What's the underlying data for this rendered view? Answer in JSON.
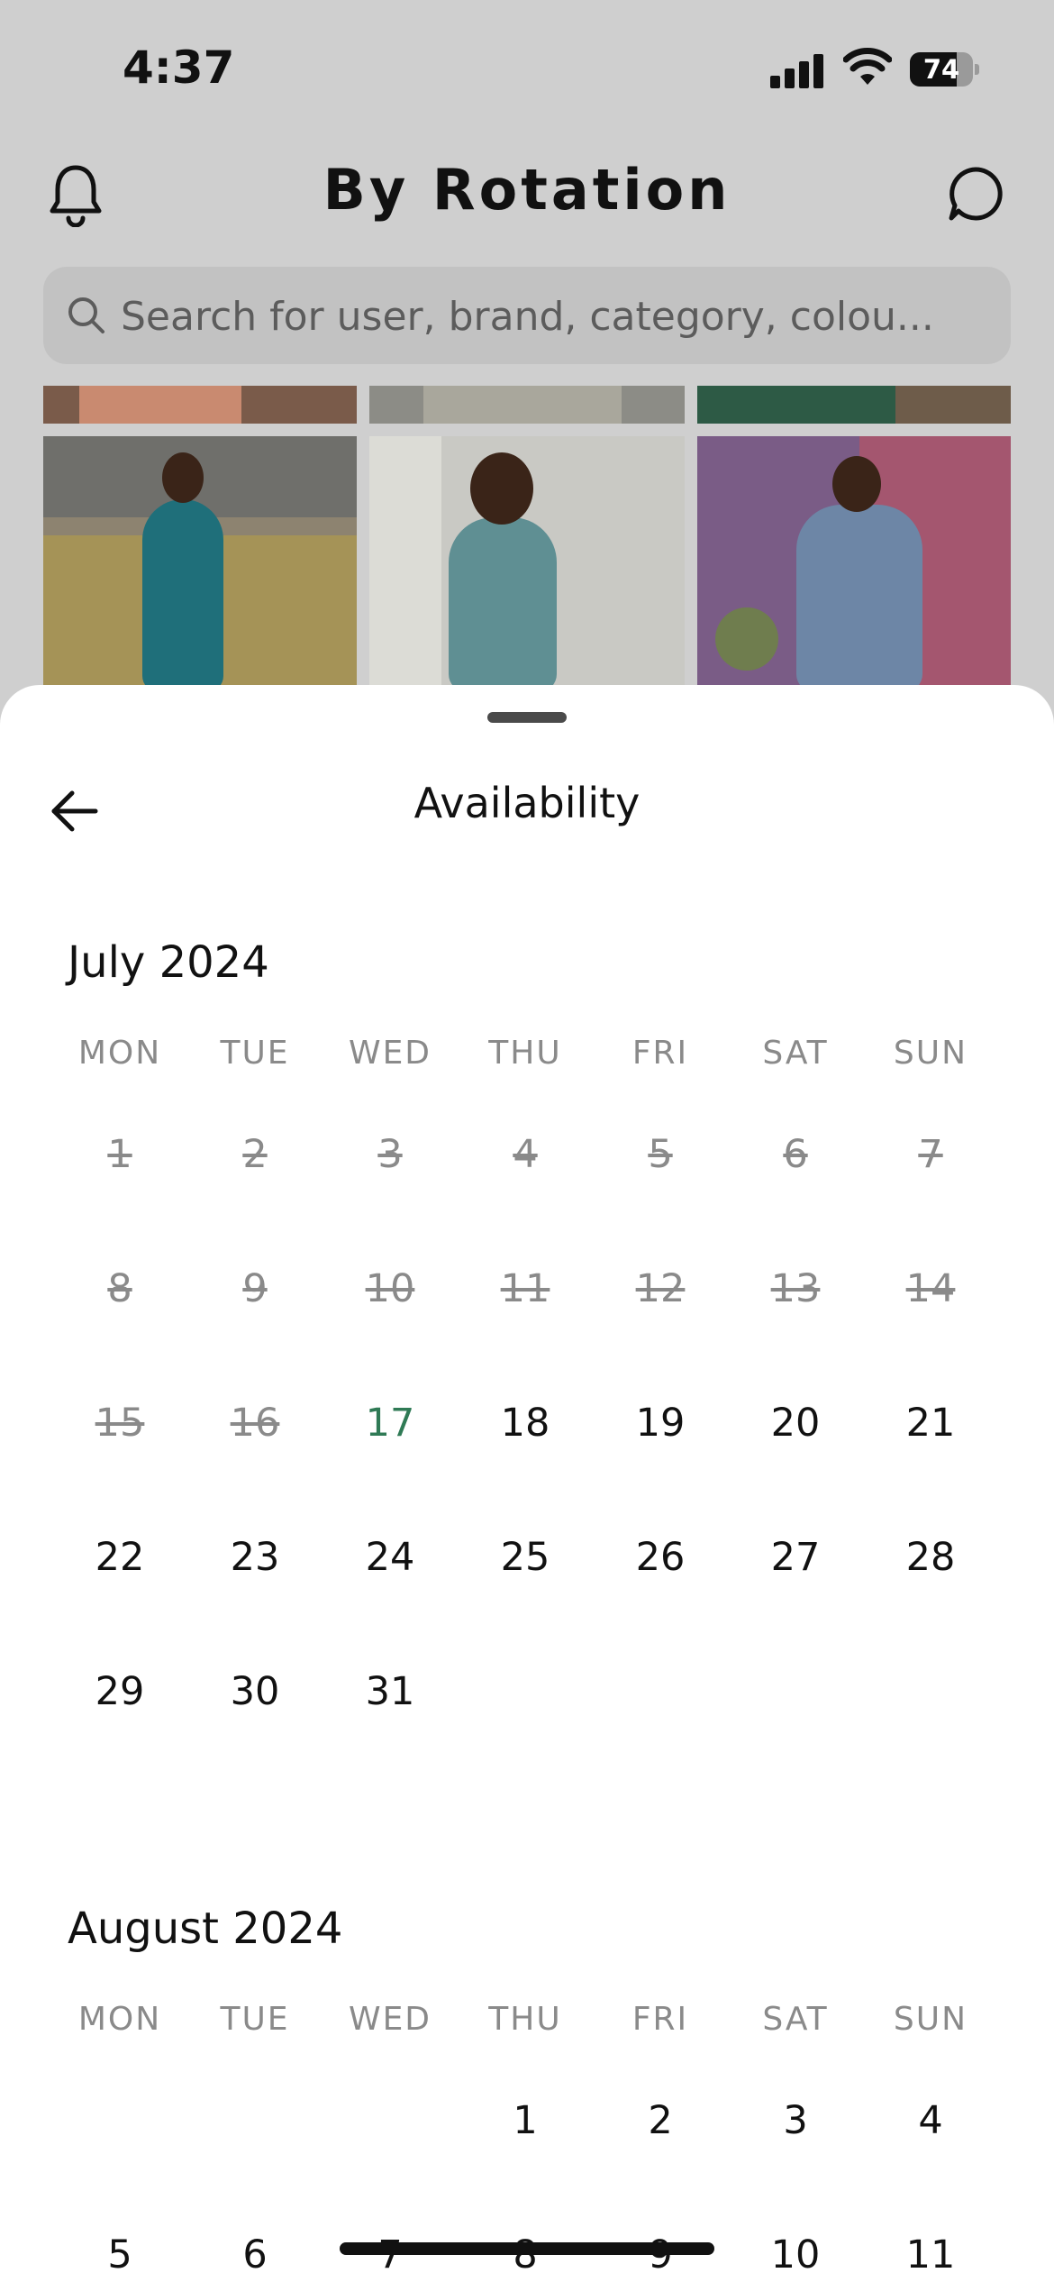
{
  "status_bar": {
    "time": "4:37",
    "battery_percent": "74",
    "battery_level": 0.74
  },
  "header": {
    "title": "By Rotation",
    "bell_icon": "bell-icon",
    "chat_icon": "chat-bubble-icon"
  },
  "search": {
    "placeholder": "Search for user, brand, category, colou..."
  },
  "sheet": {
    "title": "Availability",
    "back_icon": "arrow-left-icon",
    "colors": {
      "available": "#111111",
      "unavailable": "#8a8a8a",
      "today": "#2f7a55"
    },
    "months": [
      {
        "name": "July 2024",
        "weekdays": [
          "MON",
          "TUE",
          "WED",
          "THU",
          "FRI",
          "SAT",
          "SUN"
        ],
        "first_weekday_index": 0,
        "days": [
          {
            "n": "1",
            "state": "past"
          },
          {
            "n": "2",
            "state": "past"
          },
          {
            "n": "3",
            "state": "past"
          },
          {
            "n": "4",
            "state": "past"
          },
          {
            "n": "5",
            "state": "past"
          },
          {
            "n": "6",
            "state": "past"
          },
          {
            "n": "7",
            "state": "past"
          },
          {
            "n": "8",
            "state": "past"
          },
          {
            "n": "9",
            "state": "past"
          },
          {
            "n": "10",
            "state": "past"
          },
          {
            "n": "11",
            "state": "past"
          },
          {
            "n": "12",
            "state": "past"
          },
          {
            "n": "13",
            "state": "past"
          },
          {
            "n": "14",
            "state": "past"
          },
          {
            "n": "15",
            "state": "past"
          },
          {
            "n": "16",
            "state": "past"
          },
          {
            "n": "17",
            "state": "today"
          },
          {
            "n": "18",
            "state": "available"
          },
          {
            "n": "19",
            "state": "available"
          },
          {
            "n": "20",
            "state": "available"
          },
          {
            "n": "21",
            "state": "available"
          },
          {
            "n": "22",
            "state": "available"
          },
          {
            "n": "23",
            "state": "available"
          },
          {
            "n": "24",
            "state": "available"
          },
          {
            "n": "25",
            "state": "available"
          },
          {
            "n": "26",
            "state": "available"
          },
          {
            "n": "27",
            "state": "available"
          },
          {
            "n": "28",
            "state": "available"
          },
          {
            "n": "29",
            "state": "available"
          },
          {
            "n": "30",
            "state": "available"
          },
          {
            "n": "31",
            "state": "available"
          }
        ]
      },
      {
        "name": "August 2024",
        "weekdays": [
          "MON",
          "TUE",
          "WED",
          "THU",
          "FRI",
          "SAT",
          "SUN"
        ],
        "first_weekday_index": 3,
        "days": [
          {
            "n": "1",
            "state": "available"
          },
          {
            "n": "2",
            "state": "available"
          },
          {
            "n": "3",
            "state": "available"
          },
          {
            "n": "4",
            "state": "available"
          },
          {
            "n": "5",
            "state": "available"
          },
          {
            "n": "6",
            "state": "available"
          },
          {
            "n": "7",
            "state": "available"
          },
          {
            "n": "8",
            "state": "available"
          },
          {
            "n": "9",
            "state": "available"
          },
          {
            "n": "10",
            "state": "available"
          },
          {
            "n": "11",
            "state": "available"
          }
        ]
      }
    ]
  }
}
